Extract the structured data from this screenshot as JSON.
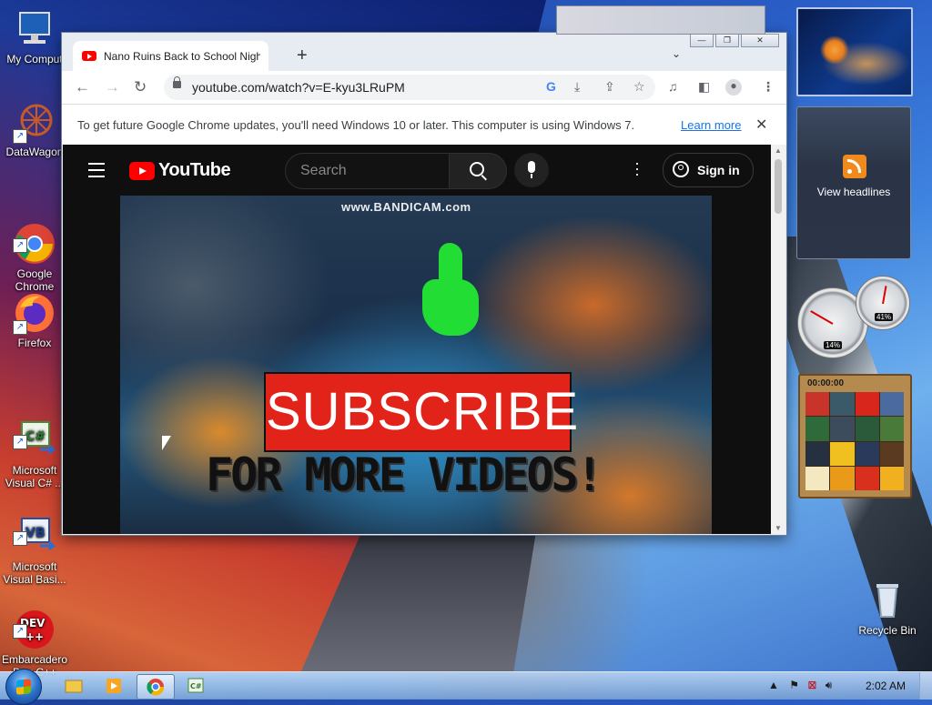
{
  "desktop": {
    "icons": [
      {
        "label": "My Comput",
        "icon": "computer-icon"
      },
      {
        "label": "DataWagon",
        "icon": "datawagon-icon"
      },
      {
        "label": "Google\nChrome",
        "icon": "chrome-icon"
      },
      {
        "label": "Firefox",
        "icon": "firefox-icon"
      },
      {
        "label": "Microsoft\nVisual C# ...",
        "icon": "visual-csharp-icon"
      },
      {
        "label": "Microsoft\nVisual Basi...",
        "icon": "visual-basic-icon"
      },
      {
        "label": "Embarcadero\nDev-C++",
        "icon": "devcpp-icon"
      },
      {
        "label": "Recycle Bin",
        "icon": "recycle-bin-icon"
      }
    ]
  },
  "browser": {
    "tab_title": "Nano Ruins Back to School Night",
    "new_tab": "+",
    "url": "youtube.com/watch?v=E-kyu3LRuPM",
    "infobar": {
      "message": "To get future Google Chrome updates, you'll need Windows 10 or later. This computer is using Windows 7.",
      "link": "Learn more"
    }
  },
  "youtube": {
    "logo_text": "YouTube",
    "search_placeholder": "Search",
    "sign_in": "Sign in",
    "video": {
      "watermark": "www.BANDICAM.com",
      "subscribe_text": "SUBSCRIBE",
      "tagline": "FOR MORE VIDEOS!"
    }
  },
  "gadgets": {
    "feed_label": "View headlines",
    "cpu_percent": "14%",
    "memory_percent": "41%",
    "puzzle_time": "00:00:00"
  },
  "taskbar": {
    "clock": "2:02 AM"
  },
  "colors": {
    "youtube_red": "#ff0000",
    "subscribe_red": "#e2231a",
    "link_blue": "#1a73e8"
  }
}
